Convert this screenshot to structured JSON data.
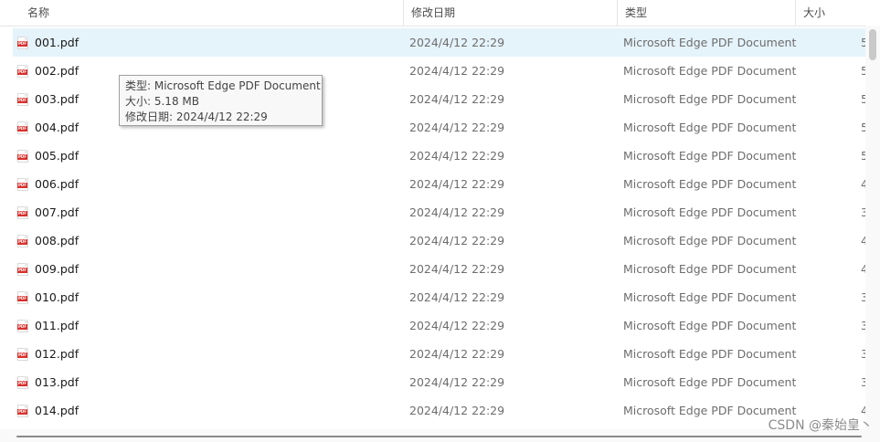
{
  "header": {
    "columns": {
      "name": "名称",
      "date": "修改日期",
      "type": "类型",
      "size": "大小"
    },
    "sort_indicator": "^"
  },
  "files": [
    {
      "name": "001.pdf",
      "date": "2024/4/12 22:29",
      "type": "Microsoft Edge PDF Document",
      "size": "5"
    },
    {
      "name": "002.pdf",
      "date": "2024/4/12 22:29",
      "type": "Microsoft Edge PDF Document",
      "size": "5"
    },
    {
      "name": "003.pdf",
      "date": "2024/4/12 22:29",
      "type": "Microsoft Edge PDF Document",
      "size": "5"
    },
    {
      "name": "004.pdf",
      "date": "2024/4/12 22:29",
      "type": "Microsoft Edge PDF Document",
      "size": "5"
    },
    {
      "name": "005.pdf",
      "date": "2024/4/12 22:29",
      "type": "Microsoft Edge PDF Document",
      "size": "5"
    },
    {
      "name": "006.pdf",
      "date": "2024/4/12 22:29",
      "type": "Microsoft Edge PDF Document",
      "size": "4"
    },
    {
      "name": "007.pdf",
      "date": "2024/4/12 22:29",
      "type": "Microsoft Edge PDF Document",
      "size": "3"
    },
    {
      "name": "008.pdf",
      "date": "2024/4/12 22:29",
      "type": "Microsoft Edge PDF Document",
      "size": "4"
    },
    {
      "name": "009.pdf",
      "date": "2024/4/12 22:29",
      "type": "Microsoft Edge PDF Document",
      "size": "4"
    },
    {
      "name": "010.pdf",
      "date": "2024/4/12 22:29",
      "type": "Microsoft Edge PDF Document",
      "size": "3"
    },
    {
      "name": "011.pdf",
      "date": "2024/4/12 22:29",
      "type": "Microsoft Edge PDF Document",
      "size": "3"
    },
    {
      "name": "012.pdf",
      "date": "2024/4/12 22:29",
      "type": "Microsoft Edge PDF Document",
      "size": "3"
    },
    {
      "name": "013.pdf",
      "date": "2024/4/12 22:29",
      "type": "Microsoft Edge PDF Document",
      "size": "3"
    },
    {
      "name": "014.pdf",
      "date": "2024/4/12 22:29",
      "type": "Microsoft Edge PDF Document",
      "size": "4"
    }
  ],
  "selected_index": 0,
  "file_icon": "pdf-file-icon",
  "file_icon_label": "PDF",
  "tooltip": {
    "type_line": "类型: Microsoft Edge PDF Document",
    "size_line": "大小: 5.18 MB",
    "date_line": "修改日期: 2024/4/12 22:29"
  },
  "watermark": "CSDN @秦始皇丶",
  "colors": {
    "selected_row": "#e5f3fb",
    "pdf_red": "#d9302c"
  }
}
